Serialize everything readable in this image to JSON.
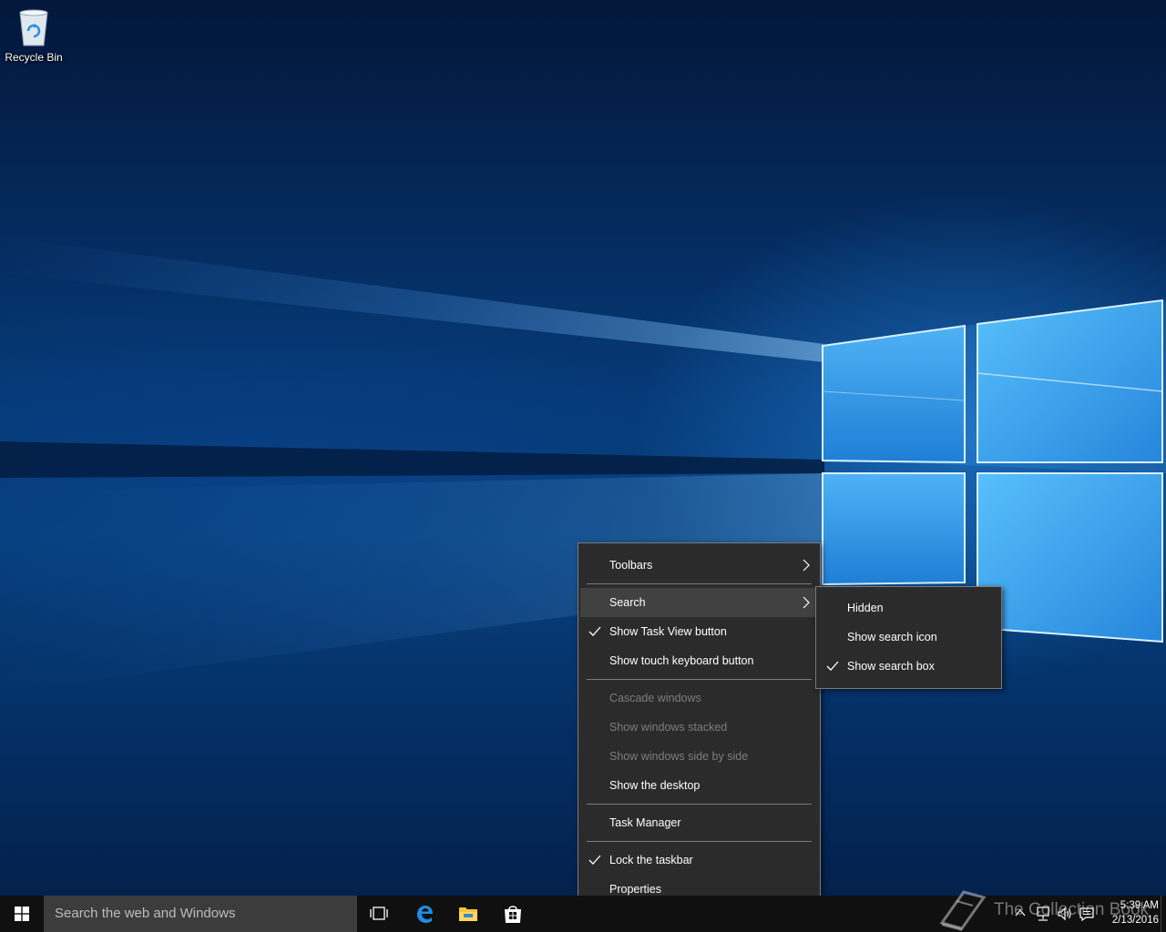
{
  "desktop": {
    "recycle_bin_label": "Recycle Bin"
  },
  "context_menu": {
    "items": [
      {
        "label": "Toolbars",
        "submenu": true
      },
      {
        "label": "Search",
        "submenu": true,
        "highlighted": true
      },
      {
        "label": "Show Task View button",
        "checked": true
      },
      {
        "label": "Show touch keyboard button"
      },
      {
        "label": "Cascade windows",
        "disabled": true
      },
      {
        "label": "Show windows stacked",
        "disabled": true
      },
      {
        "label": "Show windows side by side",
        "disabled": true
      },
      {
        "label": "Show the desktop"
      },
      {
        "label": "Task Manager"
      },
      {
        "label": "Lock the taskbar",
        "checked": true
      },
      {
        "label": "Properties"
      }
    ]
  },
  "search_submenu": {
    "items": [
      {
        "label": "Hidden"
      },
      {
        "label": "Show search icon"
      },
      {
        "label": "Show search box",
        "checked": true
      }
    ]
  },
  "taskbar": {
    "search_placeholder": "Search the web and Windows",
    "pinned": [
      "task-view-icon",
      "edge-icon",
      "file-explorer-icon",
      "store-icon"
    ],
    "clock_time": "5:39 AM",
    "clock_date": "2/13/2016"
  },
  "watermark": {
    "text": "The Collection Book"
  },
  "colors": {
    "menu_bg": "#2b2b2b",
    "menu_highlight": "#414141",
    "taskbar_bg": "#101010",
    "search_bg": "#3c3c3c",
    "accent": "#0078d7"
  }
}
